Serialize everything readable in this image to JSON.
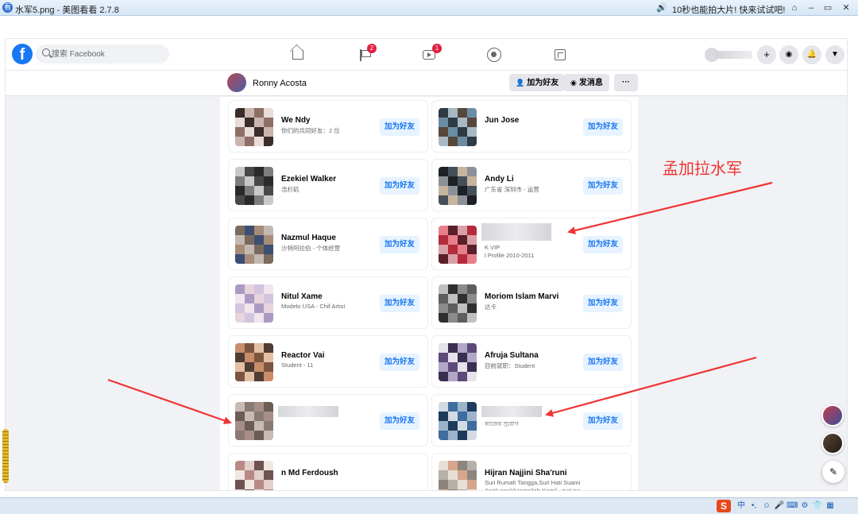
{
  "viewer": {
    "title": "水军5.png - 美图看看 2.7.8",
    "promo": "10秒也能拍大片! 快来试试吧!",
    "window_buttons": [
      "⌂",
      "–",
      "▭",
      "✕"
    ]
  },
  "fb": {
    "search_placeholder": "搜索 Facebook",
    "badges": {
      "pages": "2",
      "watch": "1"
    },
    "profile_name": "Ronny Acosta",
    "actions": {
      "add_friend": "加为好友",
      "message": "发消息",
      "more": "···"
    },
    "add_label": "加为好友"
  },
  "friends": [
    {
      "name": "We Ndy",
      "sub": "你们的共同好友：2 位",
      "col": 0,
      "row": 0
    },
    {
      "name": "Jun Jose",
      "sub": "",
      "col": 1,
      "row": 0
    },
    {
      "name": "Ezekiel Walker",
      "sub": "浩杉矶",
      "col": 0,
      "row": 1
    },
    {
      "name": "Andy Li",
      "sub": "广东省 深圳市 - 运营",
      "col": 1,
      "row": 1
    },
    {
      "name": "Nazmul Haque",
      "sub": "沙特阿拉伯 - 个体经营",
      "col": 0,
      "row": 2
    },
    {
      "name": "",
      "sub": "K VIP",
      "sub2": "l Profile 2010-2011",
      "col": 1,
      "row": 2
    },
    {
      "name": "Nitul Xame",
      "sub": "Modelo USA - Chif Artist",
      "col": 0,
      "row": 3
    },
    {
      "name": "Moriom Islam Marvi",
      "sub": "达卡",
      "col": 1,
      "row": 3
    },
    {
      "name": "Reactor Vai",
      "sub": "Student - 11",
      "col": 0,
      "row": 4
    },
    {
      "name": "Afruja Sultana",
      "sub": "目前就职：Student",
      "col": 1,
      "row": 4
    },
    {
      "name": "",
      "sub": "",
      "col": 0,
      "row": 5
    },
    {
      "name": "",
      "sub": "কাজের সুযোগ",
      "col": 1,
      "row": 5
    },
    {
      "name": "n Md Ferdoush",
      "sub": "",
      "col": 0,
      "row": 6
    },
    {
      "name": "Hijran Najjini Sha'runi",
      "sub": "Suri Rumah Tangga,Suri Hati Suami,Suri Hati",
      "sub2": "Anak-anak|Hargailah Kamil - suri rumah",
      "col": 1,
      "row": 6
    }
  ],
  "annotation": {
    "text": "孟加拉水军",
    "color": "#f03434"
  },
  "colors": {
    "fb_blue": "#1877f2",
    "badge_red": "#e41e3f",
    "add_bg": "#e7f3ff"
  },
  "taskbar": {
    "ime": "S",
    "lang": "中",
    "punct": "•,"
  }
}
